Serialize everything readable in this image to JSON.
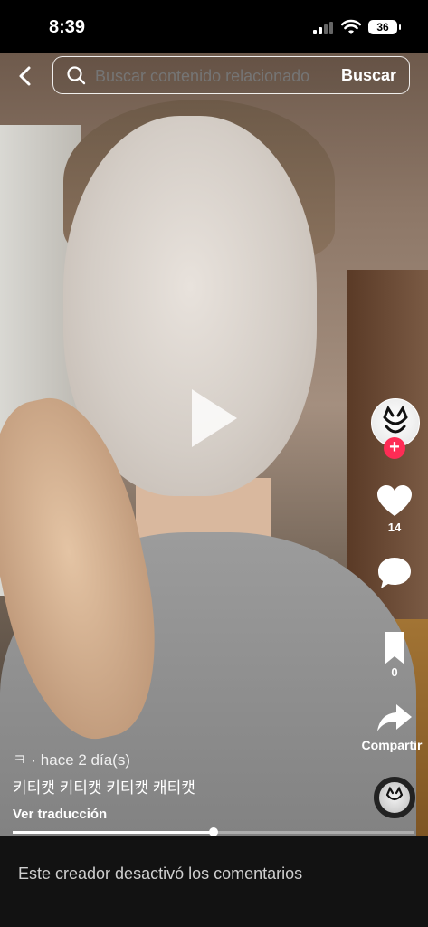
{
  "status_bar": {
    "time": "8:39",
    "battery": "36"
  },
  "search": {
    "placeholder": "Buscar contenido relacionado",
    "button_label": "Buscar"
  },
  "actions": {
    "likes": "14",
    "saves": "0",
    "share_label": "Compartir"
  },
  "video": {
    "progress": 0.5
  },
  "caption": {
    "author": "ㅋ",
    "separator": "·",
    "time_ago": "hace 2 día(s)",
    "text": "키티캣 키티캣 키티캣 캐티캣",
    "translate_label": "Ver traducción"
  },
  "comments": {
    "disabled_text": "Este creador desactivó los comentarios"
  },
  "colors": {
    "follow_accent": "#fe2c55",
    "footer_bg": "#121212"
  }
}
